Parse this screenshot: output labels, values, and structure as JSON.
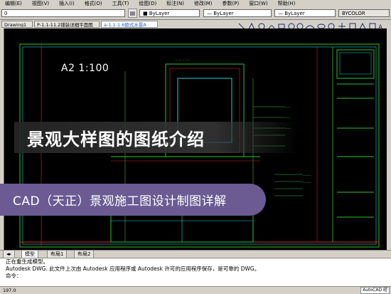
{
  "menu": [
    "编辑(E)",
    "视图(V)",
    "插入(I)",
    "格式(O)",
    "工具(T)",
    "绘图(D)",
    "标注(N)",
    "修改(M)",
    "参数(P)",
    "窗口(W)",
    "帮助(H)"
  ],
  "toolbar": {
    "layer_value": "0",
    "color_value": "ByLayer",
    "linetype_value": "ByLayer",
    "lineweight_value": "ByLayer",
    "plotstyle_value": "BYCOLOR"
  },
  "doc_tabs": [
    "Drawing1",
    "P-1.1-11.2铺装详细平面图",
    "a-1.1-1.6欧式水景A"
  ],
  "drawing": {
    "sheet_label": "A2 1:100"
  },
  "banners": {
    "title": "景观大样图的图纸介绍",
    "subtitle": "CAD（天正）景观施工图设计制图详解"
  },
  "layout_tabs": [
    "模型",
    "布局1",
    "布局2"
  ],
  "command_lines": [
    "正在重生成模型。",
    "Autodesk DWG.  此文件上次由 Autodesk 应用程序或 Autodesk 许可的应用程序保存，是可靠的 DWG。",
    "命令："
  ],
  "status": {
    "coords": "197.0",
    "app_name": "AutoCAD 经"
  },
  "colors": {
    "canvas": "#000000",
    "drawing_green": "#2ec22e",
    "drawing_cyan": "#1fd6d6",
    "drawing_red": "#d42b2b",
    "banner_purple": "#6b5b92"
  }
}
